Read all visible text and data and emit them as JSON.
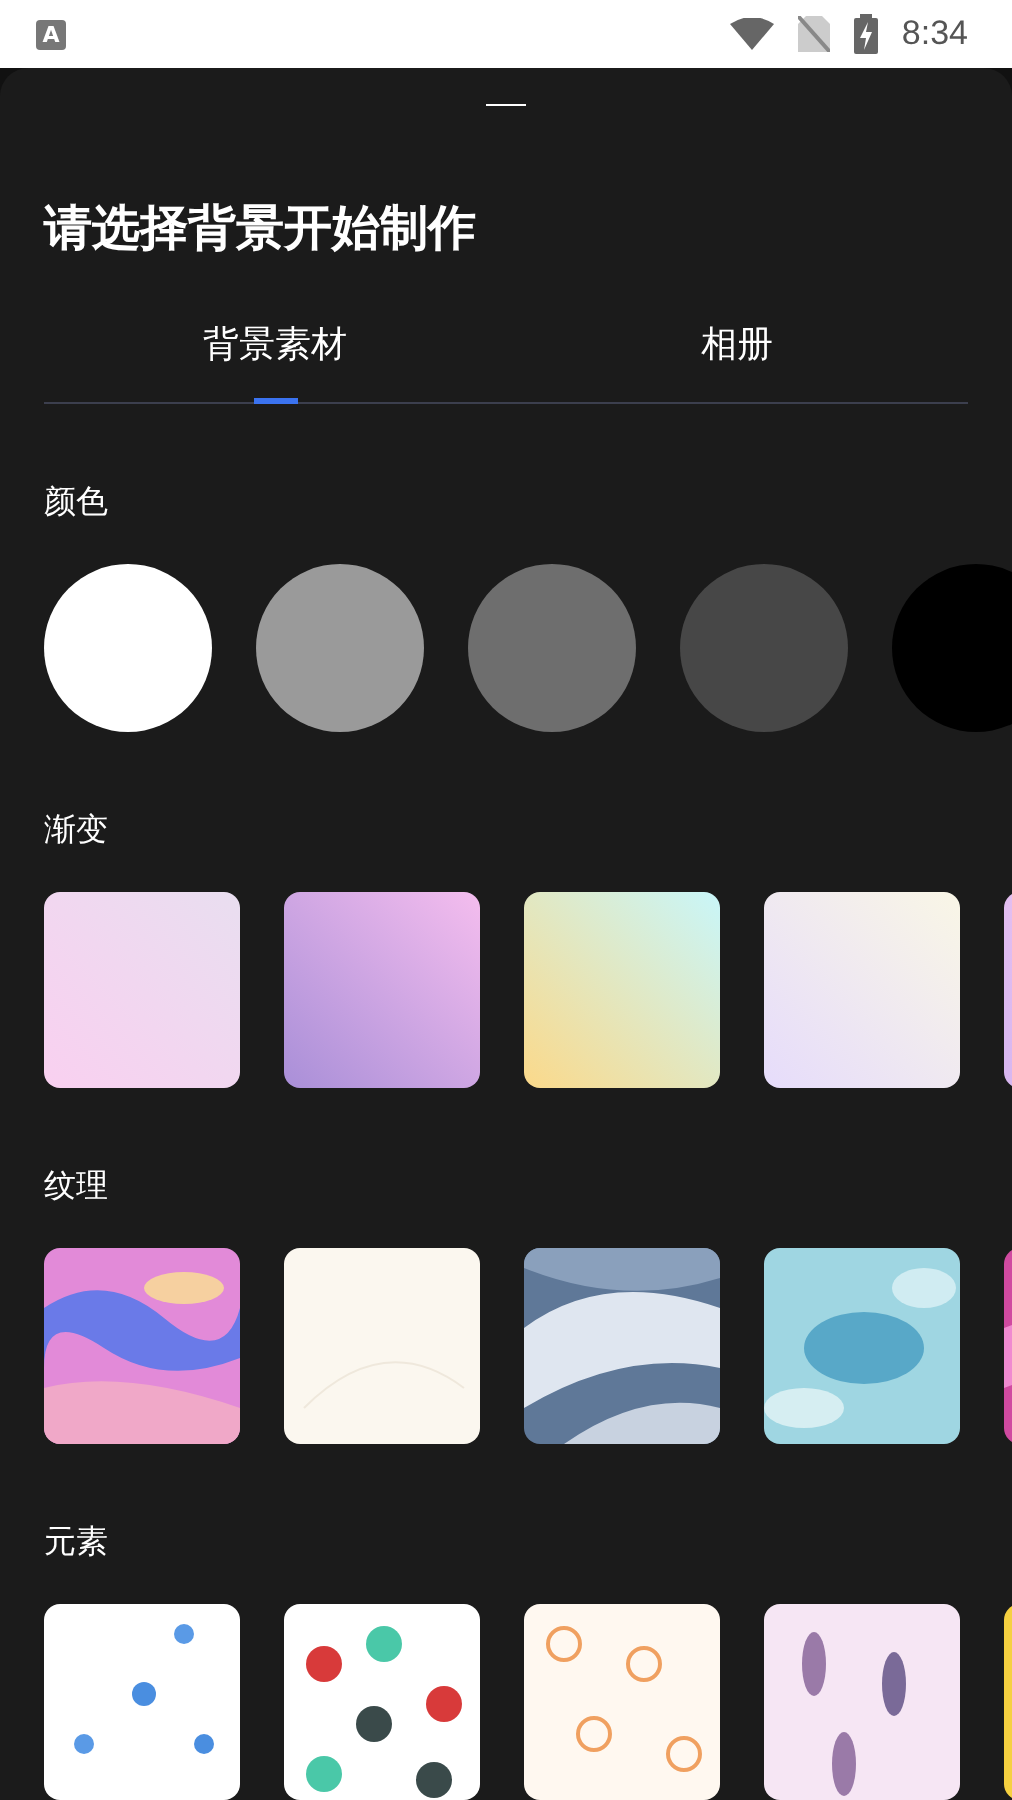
{
  "status_bar": {
    "notification": "A",
    "time": "8:34"
  },
  "sheet": {
    "title": "请选择背景开始制作",
    "tabs": [
      {
        "label": "背景素材",
        "selected": true
      },
      {
        "label": "相册",
        "selected": false
      }
    ],
    "sections": [
      {
        "title": "颜色",
        "kind": "swatches",
        "items": [
          {
            "color": "#ffffff"
          },
          {
            "color": "#9a9a9a"
          },
          {
            "color": "#6e6e6e"
          },
          {
            "color": "#474747"
          },
          {
            "color": "#000000"
          }
        ]
      },
      {
        "title": "渐变",
        "kind": "gradients"
      },
      {
        "title": "纹理",
        "kind": "pictures"
      },
      {
        "title": "元素",
        "kind": "pictures"
      }
    ]
  }
}
